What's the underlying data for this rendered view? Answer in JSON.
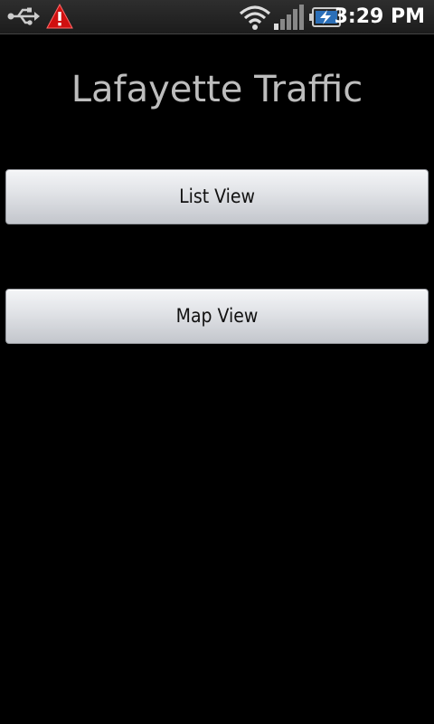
{
  "status_bar": {
    "time": "3:29 PM",
    "icons": [
      "usb-icon",
      "warning-icon",
      "wifi-icon",
      "signal-icon",
      "battery-charging-icon"
    ]
  },
  "app": {
    "title": "Lafayette Traffic"
  },
  "buttons": {
    "list_view": "List View",
    "map_view": "Map View"
  }
}
